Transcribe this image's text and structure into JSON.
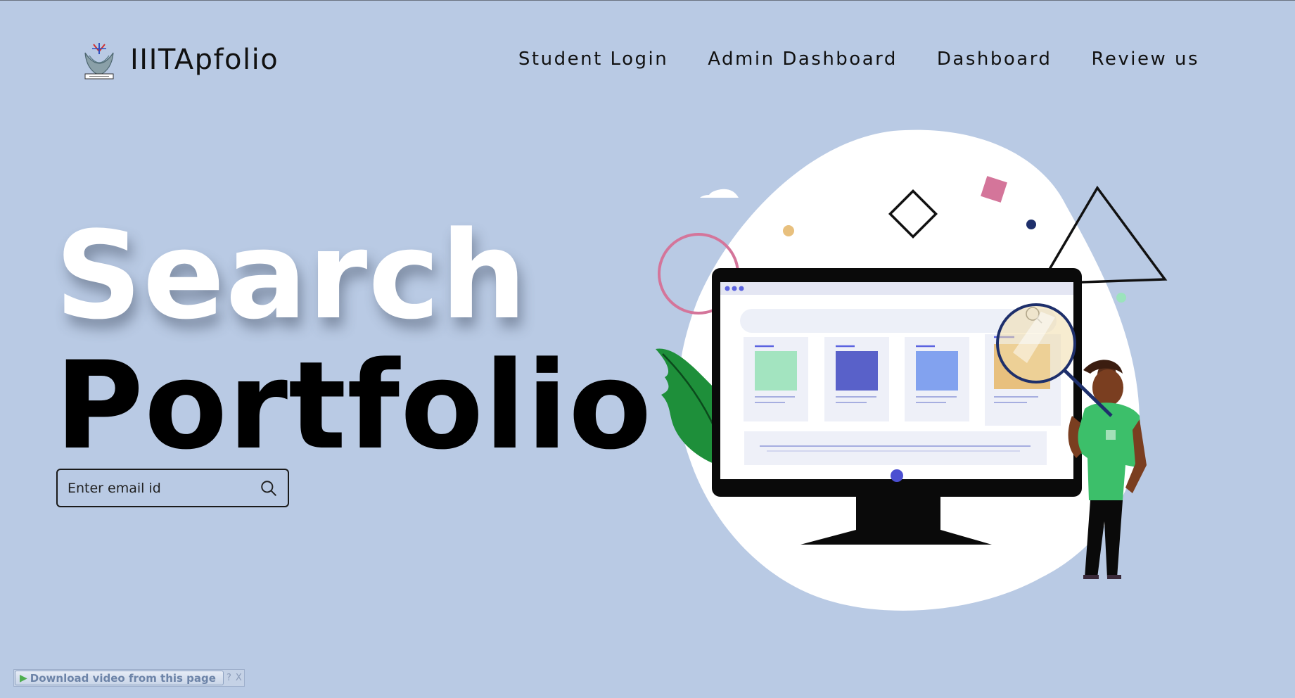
{
  "header": {
    "brand_name": "IIITApfolio",
    "logo_icon": "iiita-emblem-icon",
    "nav": [
      {
        "label": "Student Login"
      },
      {
        "label": "Admin Dashboard"
      },
      {
        "label": "Dashboard"
      },
      {
        "label": "Review us"
      }
    ]
  },
  "hero": {
    "title_line1": "Search",
    "title_line2": "Portfolio",
    "search": {
      "placeholder": "Enter email id",
      "value": "",
      "icon": "search-icon"
    }
  },
  "colors": {
    "background": "#b9cae4",
    "title_white": "#ffffff",
    "title_black": "#000000",
    "accent_green": "#3cb371",
    "accent_blue": "#4b4fd1"
  },
  "extension_bar": {
    "download_label": "Download video from this page",
    "help_label": "?",
    "close_label": "X"
  }
}
